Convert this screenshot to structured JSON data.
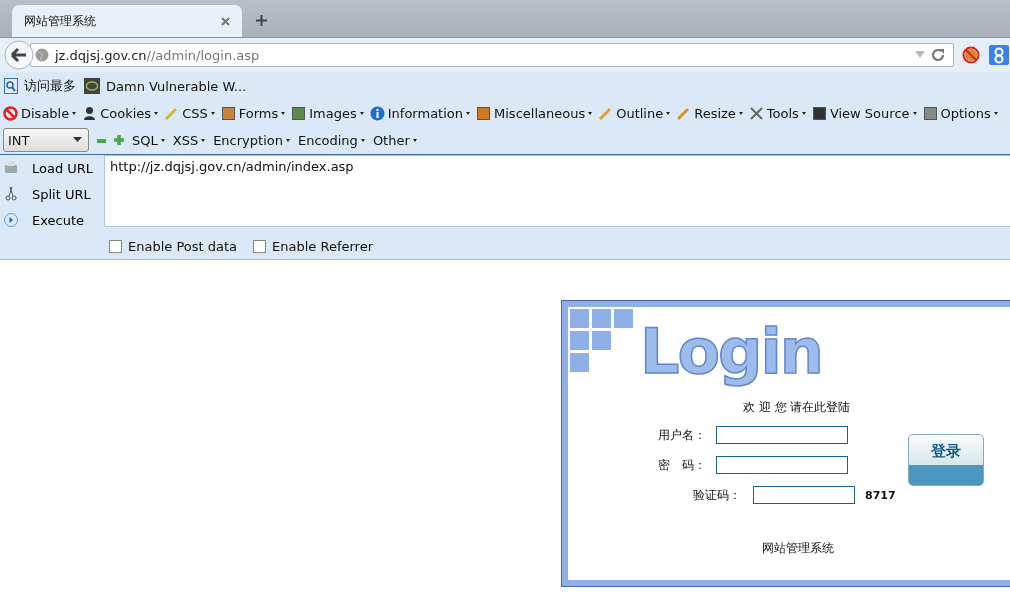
{
  "browser": {
    "tab": {
      "title": "网站管理系统",
      "selected": true
    },
    "address": {
      "host": "jz.dqjsj.gov.cn",
      "path": "//admin/login.asp"
    }
  },
  "bookmarks": [
    {
      "label": "访问最多"
    },
    {
      "label": "Damn Vulnerable W..."
    }
  ],
  "hackbar": {
    "menu": [
      "Disable",
      "Cookies",
      "CSS",
      "Forms",
      "Images",
      "Information",
      "Miscellaneous",
      "Outline",
      "Resize",
      "Tools",
      "View Source",
      "Options"
    ],
    "select": "INT",
    "menu2": [
      "SQL",
      "XSS",
      "Encryption",
      "Encoding",
      "Other"
    ],
    "actions": [
      "Load URL",
      "Split URL",
      "Execute"
    ],
    "url": "http://jz.dqjsj.gov.cn/admin/index.asp",
    "options": [
      {
        "label": "Enable Post data",
        "checked": false
      },
      {
        "label": "Enable Referrer",
        "checked": false
      }
    ]
  },
  "login": {
    "logo": "Login",
    "welcome": "欢 迎 您 请在此登陆",
    "fields": [
      {
        "kind": "text",
        "label": "用户名："
      },
      {
        "kind": "password",
        "label": "密　码："
      },
      {
        "kind": "captcha",
        "label": "验证码：",
        "code": "8717"
      }
    ],
    "button": "登录",
    "footer": "网站管理系统"
  }
}
